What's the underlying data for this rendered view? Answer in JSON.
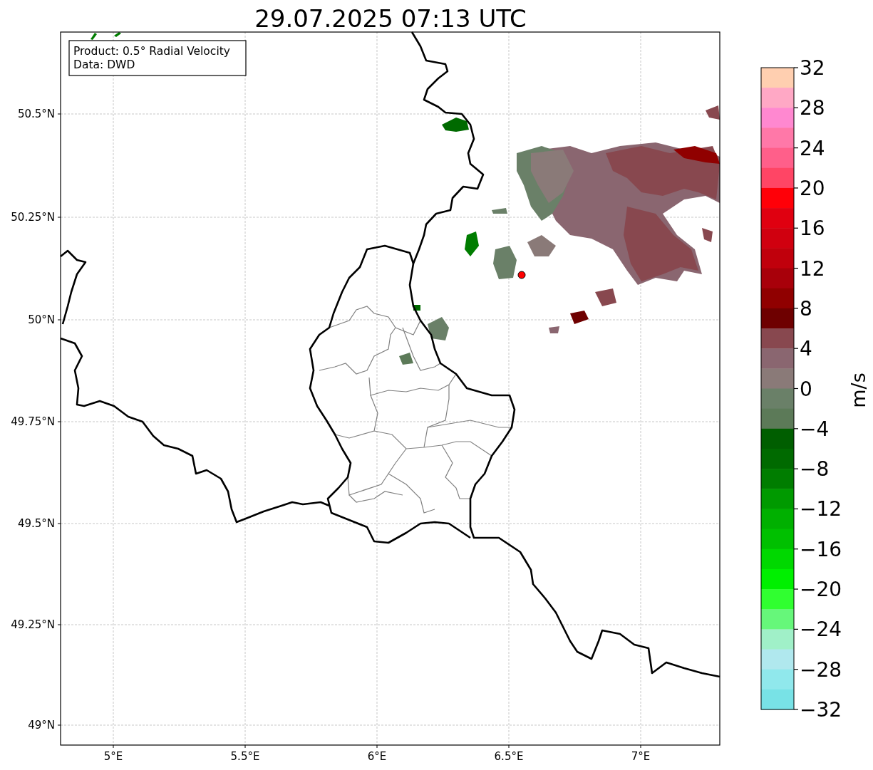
{
  "title": "29.07.2025 07:13 UTC",
  "info_box": {
    "lines": [
      "Product: 0.5° Radial Velocity",
      "Data: DWD"
    ]
  },
  "map": {
    "x_ticks": [
      "5°E",
      "5.5°E",
      "6°E",
      "6.5°E",
      "7°E"
    ],
    "y_ticks": [
      "50.5°N",
      "50.25°N",
      "50°N",
      "49.75°N",
      "49.5°N",
      "49.25°N",
      "49°N"
    ]
  },
  "colorbar": {
    "label": "m/s",
    "ticks": [
      "32",
      "28",
      "24",
      "20",
      "16",
      "12",
      "8",
      "4",
      "0",
      "−4",
      "−8",
      "−12",
      "−16",
      "−20",
      "−24",
      "−28",
      "−32"
    ],
    "segments": [
      {
        "color": "#ffcfb0"
      },
      {
        "color": "#ffa8c5"
      },
      {
        "color": "#ff88d0"
      },
      {
        "color": "#ff78a8"
      },
      {
        "color": "#ff5f8a"
      },
      {
        "color": "#ff4565"
      },
      {
        "color": "#ff0008"
      },
      {
        "color": "#e00010"
      },
      {
        "color": "#d0000f"
      },
      {
        "color": "#c0000c"
      },
      {
        "color": "#a8000a"
      },
      {
        "color": "#900000"
      },
      {
        "color": "#6e0000"
      },
      {
        "color": "#88484f"
      },
      {
        "color": "#8a6670"
      },
      {
        "color": "#8a7a78"
      },
      {
        "color": "#6a8068"
      },
      {
        "color": "#5c7a58"
      },
      {
        "color": "#005e00"
      },
      {
        "color": "#006a00"
      },
      {
        "color": "#007d00"
      },
      {
        "color": "#009a00"
      },
      {
        "color": "#00b000"
      },
      {
        "color": "#00c000"
      },
      {
        "color": "#00d800"
      },
      {
        "color": "#00f000"
      },
      {
        "color": "#30ff30"
      },
      {
        "color": "#66f77a"
      },
      {
        "color": "#a0f0c8"
      },
      {
        "color": "#b0e8ee"
      },
      {
        "color": "#90e8ec"
      },
      {
        "color": "#78e2e6"
      }
    ]
  }
}
